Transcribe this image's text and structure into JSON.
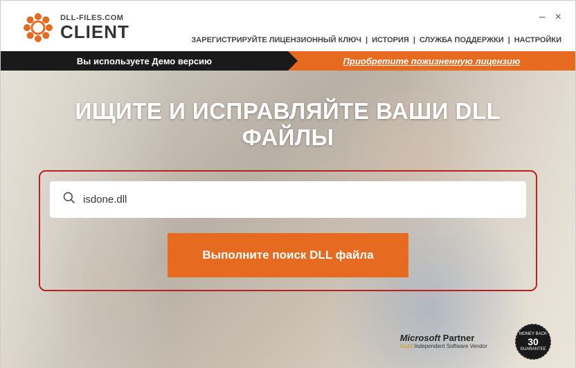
{
  "logo": {
    "domain": "DLL-FILES.COM",
    "product": "CLIENT"
  },
  "window": {
    "minimize": "–",
    "close": "×"
  },
  "topNav": {
    "register": "ЗАРЕГИСТРИРУЙТЕ ЛИЦЕНЗИОННЫЙ КЛЮЧ",
    "history": "ИСТОРИЯ",
    "support": "СЛУЖБА ПОДДЕРЖКИ",
    "settings": "НАСТРОЙКИ",
    "sep": " | "
  },
  "banner": {
    "demo": "Вы используете Демо версию",
    "buy": "Приобретите пожизненную лицензию"
  },
  "hero": {
    "title": "ИЩИТЕ И ИСПРАВЛЯЙТЕ ВАШИ DLL ФАЙЛЫ"
  },
  "search": {
    "value": "isdone.dll",
    "button": "Выполните поиск DLL файла"
  },
  "footer": {
    "msPartnerLine1a": "Microsoft",
    "msPartnerLine1b": " Partner",
    "msPartnerLine2a": "Gold",
    "msPartnerLine2b": " Independent Software Vendor",
    "guaranteeTop": "MONEY BACK",
    "guaranteeNum": "30",
    "guaranteeBottom": "GUARANTEE"
  }
}
